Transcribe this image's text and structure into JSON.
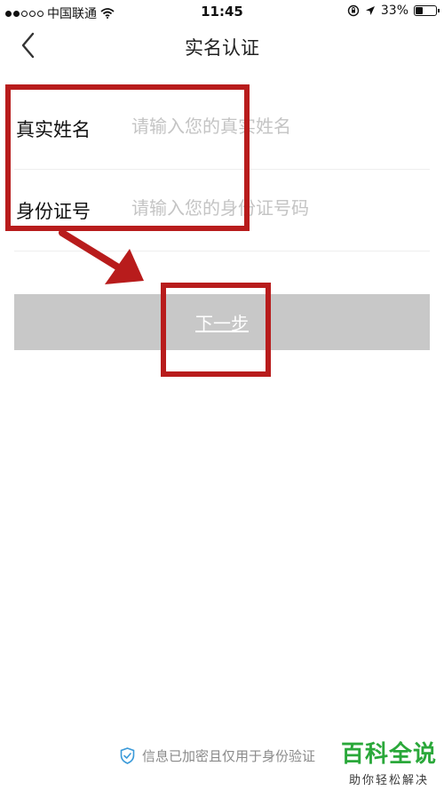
{
  "status_bar": {
    "carrier": "中国联通",
    "time": "11:45",
    "battery": "33%",
    "battery_level": 0.33,
    "icons": [
      "signal-dots-icon",
      "wifi-icon",
      "rotation-lock-icon",
      "location-arrow-icon",
      "battery-icon"
    ]
  },
  "nav": {
    "title": "实名认证",
    "back_icon": "chevron-left-icon"
  },
  "form": {
    "name_label": "真实姓名",
    "name_placeholder": "请输入您的真实姓名",
    "name_value": "",
    "id_label": "身份证号",
    "id_placeholder": "请输入您的身份证号码",
    "id_value": ""
  },
  "next_button": {
    "label": "下一步"
  },
  "footer": {
    "note": "信息已加密且仅用于身份验证",
    "icon": "shield-check-icon"
  },
  "watermark": {
    "title": "百科全说",
    "subtitle": "助你轻松解决"
  },
  "colors": {
    "annotation": "#b81c1c",
    "button_disabled": "#c8c8c8",
    "placeholder": "#c4c4c4",
    "watermark_green": "#2aa83a",
    "shield_blue": "#3a9ad9"
  }
}
